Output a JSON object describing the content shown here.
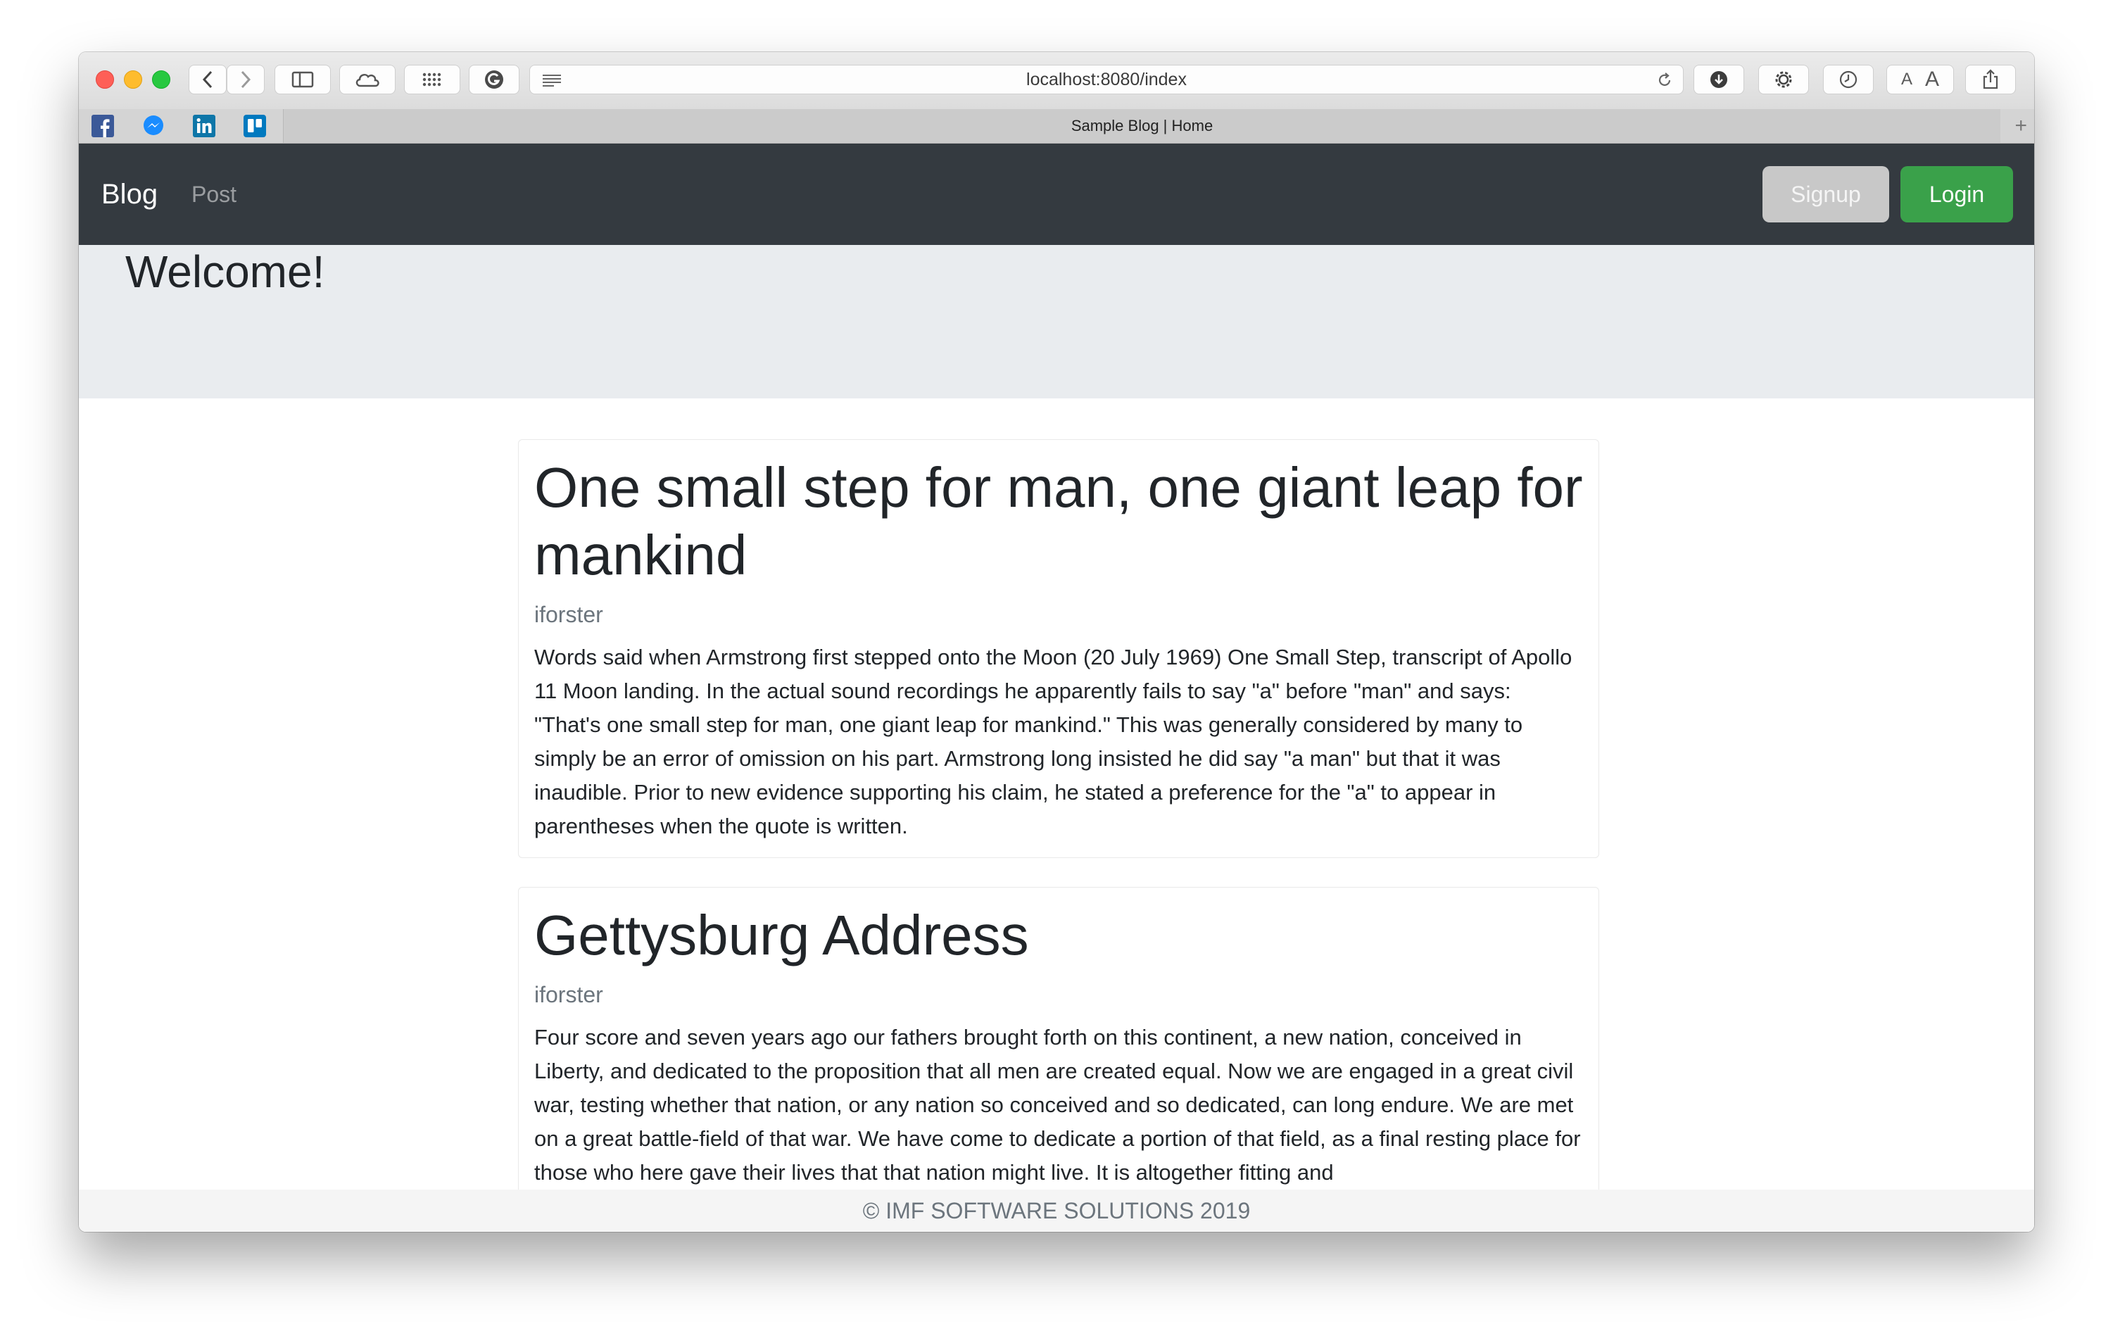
{
  "browser": {
    "url": "localhost:8080/index",
    "tab_title": "Sample Blog | Home",
    "bookmarks": [
      "facebook-icon",
      "messenger-icon",
      "linkedin-icon",
      "trello-icon"
    ]
  },
  "navbar": {
    "brand": "Blog",
    "links": [
      "Post"
    ],
    "signup_label": "Signup",
    "login_label": "Login"
  },
  "jumbotron": {
    "title": "Welcome!"
  },
  "posts": [
    {
      "title": "One small step for man, one giant leap for mankind",
      "author": "iforster",
      "body": "Words said when Armstrong first stepped onto the Moon (20 July 1969) One Small Step, transcript of Apollo 11 Moon landing. In the actual sound recordings he apparently fails to say \"a\" before \"man\" and says: \"That's one small step for man, one giant leap for mankind.\" This was generally considered by many to simply be an error of omission on his part. Armstrong long insisted he did say \"a man\" but that it was inaudible. Prior to new evidence supporting his claim, he stated a preference for the \"a\" to appear in parentheses when the quote is written."
    },
    {
      "title": "Gettysburg Address",
      "author": "iforster",
      "body": "Four score and seven years ago our fathers brought forth on this continent, a new nation, conceived in Liberty, and dedicated to the proposition that all men are created equal. Now we are engaged in a great civil war, testing whether that nation, or any nation so conceived and so dedicated, can long endure. We are met on a great battle-field of that war. We have come to dedicate a portion of that field, as a final resting place for those who here gave their lives that that nation might live. It is altogether fitting and"
    }
  ],
  "footer": {
    "text": "© IMF SOFTWARE SOLUTIONS 2019"
  },
  "colors": {
    "navbar_bg": "#343a40",
    "login_green": "#3aa14a",
    "signup_gray": "#c8c8c8",
    "jumbotron_bg": "#e9ecef"
  }
}
